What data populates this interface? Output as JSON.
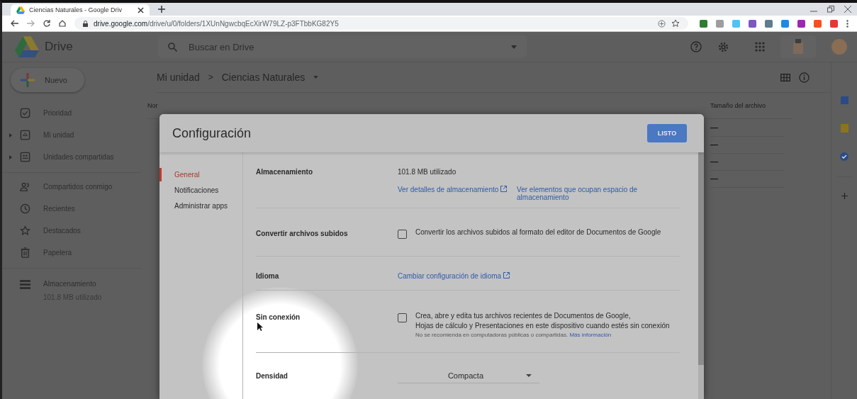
{
  "browser": {
    "tab_title": "Ciencias Naturales - Google Driv",
    "url_host": "drive.google.com",
    "url_path": "/drive/u/0/folders/1XUnNgwcbqEcXirW79LZ-p3FTbbKG82Y5"
  },
  "drive": {
    "logo": "Drive",
    "search": {
      "placeholder": "Buscar en Drive"
    },
    "new_button": "Nuevo",
    "sidebar": [
      {
        "label": "Prioridad",
        "expandable": false
      },
      {
        "label": "Mi unidad",
        "expandable": true
      },
      {
        "label": "Unidades compartidas",
        "expandable": true
      },
      {
        "label": "Compartidos conmigo",
        "expandable": false
      },
      {
        "label": "Recientes",
        "expandable": false
      },
      {
        "label": "Destacados",
        "expandable": false
      },
      {
        "label": "Papelera",
        "expandable": false
      }
    ],
    "storage": {
      "label": "Almacenamiento",
      "usage": "101.8 MB utilizado"
    },
    "breadcrumb": [
      "Mi unidad",
      "Ciencias Naturales"
    ],
    "breadcrumb_separator": ">",
    "table": {
      "columns": [
        "Nor",
        "Tamaño del archivo"
      ],
      "rows": [
        "—",
        "—",
        "—",
        "—"
      ]
    }
  },
  "settings": {
    "title": "Configuración",
    "done_button": "LISTO",
    "nav": [
      {
        "label": "General",
        "selected": true
      },
      {
        "label": "Notificaciones",
        "selected": false
      },
      {
        "label": "Administrar apps",
        "selected": false
      }
    ],
    "sections": [
      {
        "kind": "storage",
        "label": "Almacenamiento",
        "usage": "101.8 MB utilizado",
        "links": [
          "Ver detalles de almacenamiento",
          "Ver elementos que ocupan espacio de almacenamiento"
        ]
      },
      {
        "kind": "checkbox",
        "label": "Convertir archivos subidos",
        "checked": false,
        "lines": [
          "Convertir los archivos subidos al formato del editor de Documentos de Google"
        ]
      },
      {
        "kind": "link",
        "label": "Idioma",
        "link": "Cambiar configuración de idioma"
      },
      {
        "kind": "checkbox",
        "label": "Sin conexión",
        "checked": false,
        "lines": [
          "Crea, abre y edita tus archivos recientes de Documentos de Google,",
          "Hojas de cálculo y Presentaciones en este dispositivo cuando estés sin conexión"
        ],
        "note": "No se recomienda en computadoras públicas o compartidas.",
        "note_link": "Más información"
      },
      {
        "kind": "select",
        "label": "Densidad",
        "value": "Compacta"
      }
    ]
  }
}
